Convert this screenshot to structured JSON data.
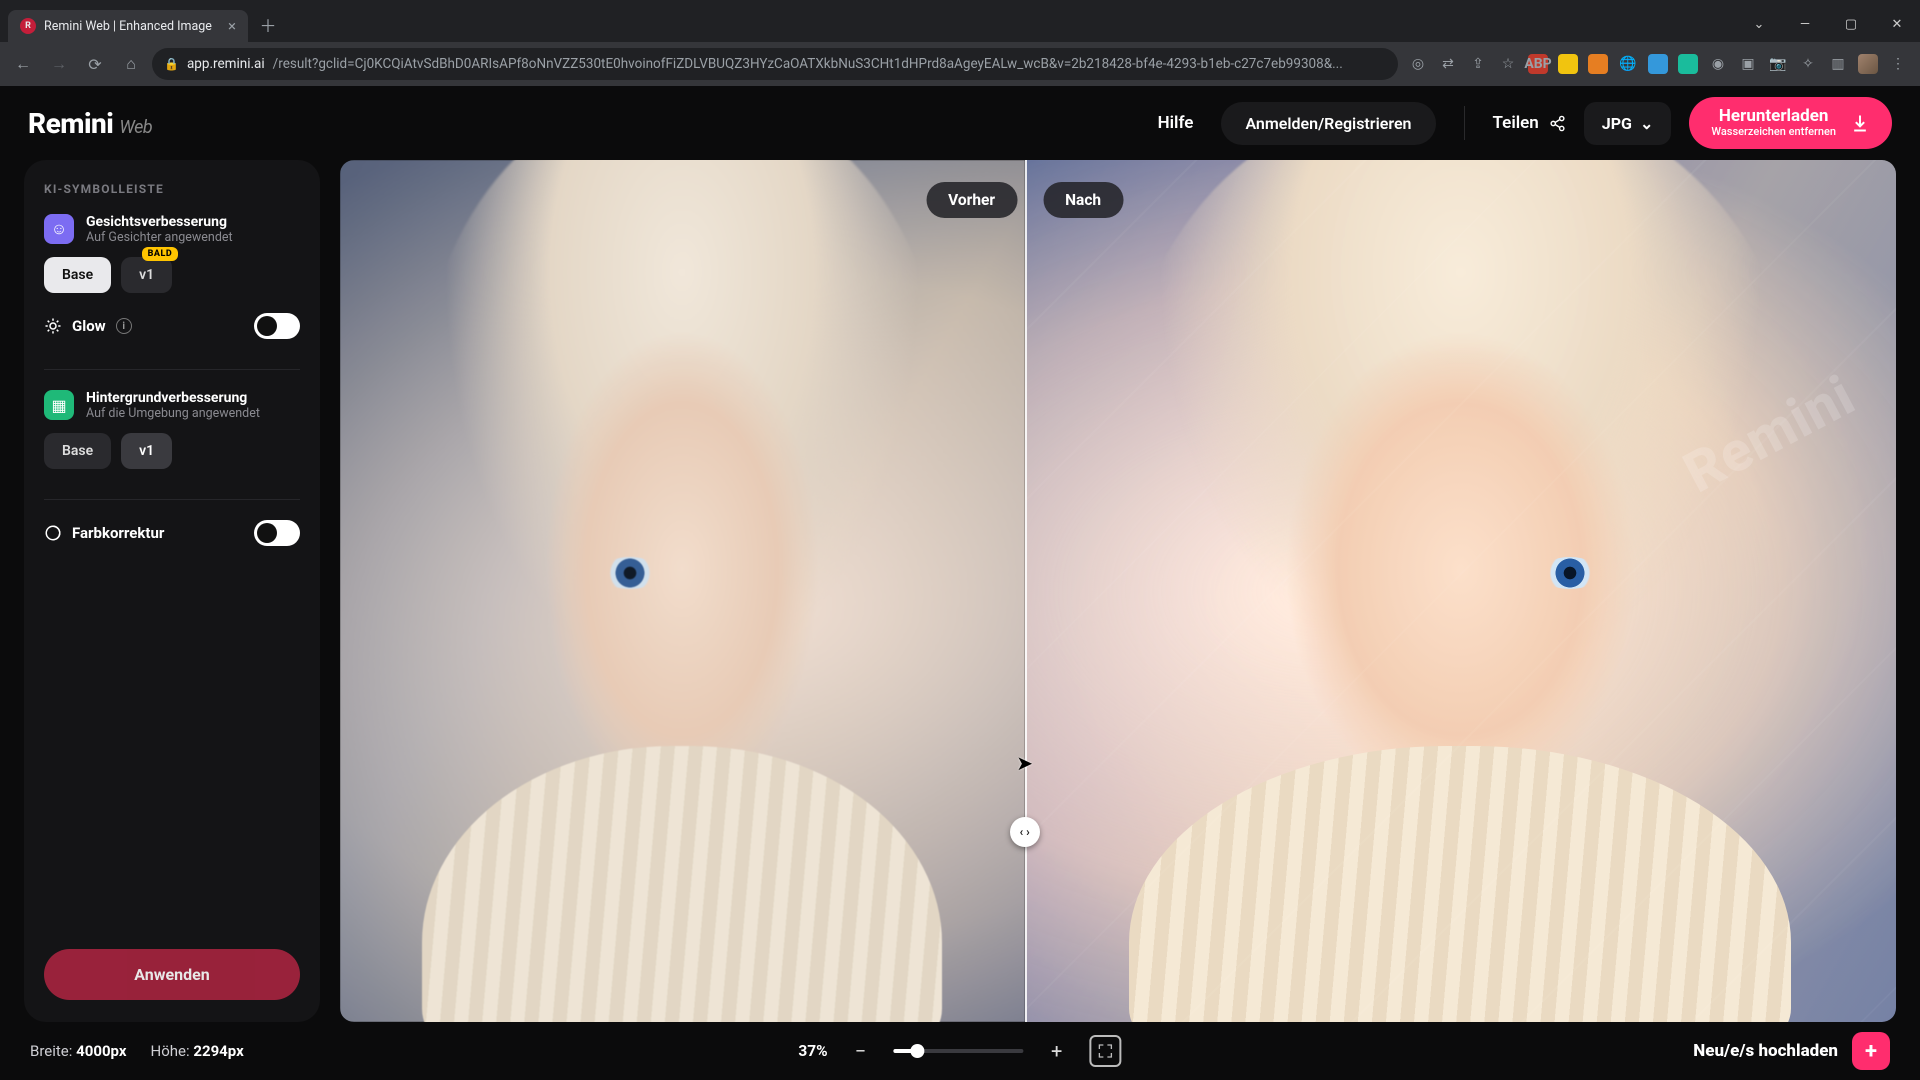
{
  "browser": {
    "tab_title": "Remini Web | Enhanced Image",
    "url_domain": "app.remini.ai",
    "url_path": "/result?gclid=Cj0KCQiAtvSdBhD0ARIsAPf8oNnVZZ530tE0hvoinofFiZDLVBUQZ3HYzCaOATXkbNuS3CHt1dHPrd8aAgeyEALw_wcB&v=2b218428-bf4e-4293-b1eb-c27c7eb99308&..."
  },
  "logo": {
    "main": "Remini",
    "sub": "Web"
  },
  "header": {
    "help": "Hilfe",
    "login": "Anmelden/Registrieren",
    "share": "Teilen",
    "format": "JPG",
    "download": "Herunterladen",
    "download_sub": "Wasserzeichen entfernen"
  },
  "sidebar": {
    "title": "KI-SYMBOLLEISTE",
    "face": {
      "title": "Gesichtsverbesserung",
      "subtitle": "Auf Gesichter angewendet",
      "chips": {
        "base": "Base",
        "v1": "v1",
        "badge": "BALD"
      }
    },
    "glow": {
      "label": "Glow"
    },
    "bg": {
      "title": "Hintergrundverbesserung",
      "subtitle": "Auf die Umgebung angewendet",
      "chips": {
        "base": "Base",
        "v1": "v1"
      }
    },
    "color": {
      "label": "Farbkorrektur"
    },
    "apply": "Anwenden"
  },
  "compare": {
    "before": "Vorher",
    "after": "Nach",
    "watermark": "Remini"
  },
  "footer": {
    "width_label": "Breite:",
    "width_value": "4000px",
    "height_label": "Höhe:",
    "height_value": "2294px",
    "zoom": "37%",
    "upload": "Neu/e/s hochladen"
  }
}
